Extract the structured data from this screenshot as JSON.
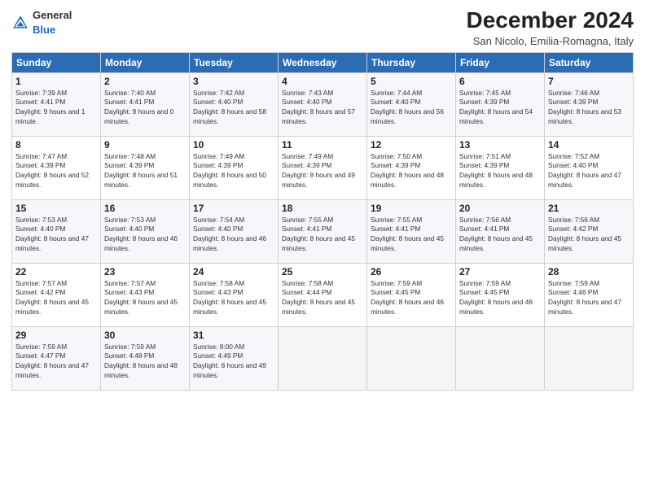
{
  "header": {
    "logo_general": "General",
    "logo_blue": "Blue",
    "month_title": "December 2024",
    "subtitle": "San Nicolo, Emilia-Romagna, Italy"
  },
  "columns": [
    "Sunday",
    "Monday",
    "Tuesday",
    "Wednesday",
    "Thursday",
    "Friday",
    "Saturday"
  ],
  "weeks": [
    [
      {
        "day": "1",
        "rise": "Sunrise: 7:39 AM",
        "set": "Sunset: 4:41 PM",
        "daylight": "Daylight: 9 hours and 1 minute."
      },
      {
        "day": "2",
        "rise": "Sunrise: 7:40 AM",
        "set": "Sunset: 4:41 PM",
        "daylight": "Daylight: 9 hours and 0 minutes."
      },
      {
        "day": "3",
        "rise": "Sunrise: 7:42 AM",
        "set": "Sunset: 4:40 PM",
        "daylight": "Daylight: 8 hours and 58 minutes."
      },
      {
        "day": "4",
        "rise": "Sunrise: 7:43 AM",
        "set": "Sunset: 4:40 PM",
        "daylight": "Daylight: 8 hours and 57 minutes."
      },
      {
        "day": "5",
        "rise": "Sunrise: 7:44 AM",
        "set": "Sunset: 4:40 PM",
        "daylight": "Daylight: 8 hours and 56 minutes."
      },
      {
        "day": "6",
        "rise": "Sunrise: 7:45 AM",
        "set": "Sunset: 4:39 PM",
        "daylight": "Daylight: 8 hours and 54 minutes."
      },
      {
        "day": "7",
        "rise": "Sunrise: 7:46 AM",
        "set": "Sunset: 4:39 PM",
        "daylight": "Daylight: 8 hours and 53 minutes."
      }
    ],
    [
      {
        "day": "8",
        "rise": "Sunrise: 7:47 AM",
        "set": "Sunset: 4:39 PM",
        "daylight": "Daylight: 8 hours and 52 minutes."
      },
      {
        "day": "9",
        "rise": "Sunrise: 7:48 AM",
        "set": "Sunset: 4:39 PM",
        "daylight": "Daylight: 8 hours and 51 minutes."
      },
      {
        "day": "10",
        "rise": "Sunrise: 7:49 AM",
        "set": "Sunset: 4:39 PM",
        "daylight": "Daylight: 8 hours and 50 minutes."
      },
      {
        "day": "11",
        "rise": "Sunrise: 7:49 AM",
        "set": "Sunset: 4:39 PM",
        "daylight": "Daylight: 8 hours and 49 minutes."
      },
      {
        "day": "12",
        "rise": "Sunrise: 7:50 AM",
        "set": "Sunset: 4:39 PM",
        "daylight": "Daylight: 8 hours and 48 minutes."
      },
      {
        "day": "13",
        "rise": "Sunrise: 7:51 AM",
        "set": "Sunset: 4:39 PM",
        "daylight": "Daylight: 8 hours and 48 minutes."
      },
      {
        "day": "14",
        "rise": "Sunrise: 7:52 AM",
        "set": "Sunset: 4:40 PM",
        "daylight": "Daylight: 8 hours and 47 minutes."
      }
    ],
    [
      {
        "day": "15",
        "rise": "Sunrise: 7:53 AM",
        "set": "Sunset: 4:40 PM",
        "daylight": "Daylight: 8 hours and 47 minutes."
      },
      {
        "day": "16",
        "rise": "Sunrise: 7:53 AM",
        "set": "Sunset: 4:40 PM",
        "daylight": "Daylight: 8 hours and 46 minutes."
      },
      {
        "day": "17",
        "rise": "Sunrise: 7:54 AM",
        "set": "Sunset: 4:40 PM",
        "daylight": "Daylight: 8 hours and 46 minutes."
      },
      {
        "day": "18",
        "rise": "Sunrise: 7:55 AM",
        "set": "Sunset: 4:41 PM",
        "daylight": "Daylight: 8 hours and 45 minutes."
      },
      {
        "day": "19",
        "rise": "Sunrise: 7:55 AM",
        "set": "Sunset: 4:41 PM",
        "daylight": "Daylight: 8 hours and 45 minutes."
      },
      {
        "day": "20",
        "rise": "Sunrise: 7:56 AM",
        "set": "Sunset: 4:41 PM",
        "daylight": "Daylight: 8 hours and 45 minutes."
      },
      {
        "day": "21",
        "rise": "Sunrise: 7:56 AM",
        "set": "Sunset: 4:42 PM",
        "daylight": "Daylight: 8 hours and 45 minutes."
      }
    ],
    [
      {
        "day": "22",
        "rise": "Sunrise: 7:57 AM",
        "set": "Sunset: 4:42 PM",
        "daylight": "Daylight: 8 hours and 45 minutes."
      },
      {
        "day": "23",
        "rise": "Sunrise: 7:57 AM",
        "set": "Sunset: 4:43 PM",
        "daylight": "Daylight: 8 hours and 45 minutes."
      },
      {
        "day": "24",
        "rise": "Sunrise: 7:58 AM",
        "set": "Sunset: 4:43 PM",
        "daylight": "Daylight: 8 hours and 45 minutes."
      },
      {
        "day": "25",
        "rise": "Sunrise: 7:58 AM",
        "set": "Sunset: 4:44 PM",
        "daylight": "Daylight: 8 hours and 45 minutes."
      },
      {
        "day": "26",
        "rise": "Sunrise: 7:59 AM",
        "set": "Sunset: 4:45 PM",
        "daylight": "Daylight: 8 hours and 46 minutes."
      },
      {
        "day": "27",
        "rise": "Sunrise: 7:59 AM",
        "set": "Sunset: 4:45 PM",
        "daylight": "Daylight: 8 hours and 46 minutes."
      },
      {
        "day": "28",
        "rise": "Sunrise: 7:59 AM",
        "set": "Sunset: 4:46 PM",
        "daylight": "Daylight: 8 hours and 47 minutes."
      }
    ],
    [
      {
        "day": "29",
        "rise": "Sunrise: 7:59 AM",
        "set": "Sunset: 4:47 PM",
        "daylight": "Daylight: 8 hours and 47 minutes."
      },
      {
        "day": "30",
        "rise": "Sunrise: 7:59 AM",
        "set": "Sunset: 4:48 PM",
        "daylight": "Daylight: 8 hours and 48 minutes."
      },
      {
        "day": "31",
        "rise": "Sunrise: 8:00 AM",
        "set": "Sunset: 4:49 PM",
        "daylight": "Daylight: 8 hours and 49 minutes."
      },
      null,
      null,
      null,
      null
    ]
  ]
}
